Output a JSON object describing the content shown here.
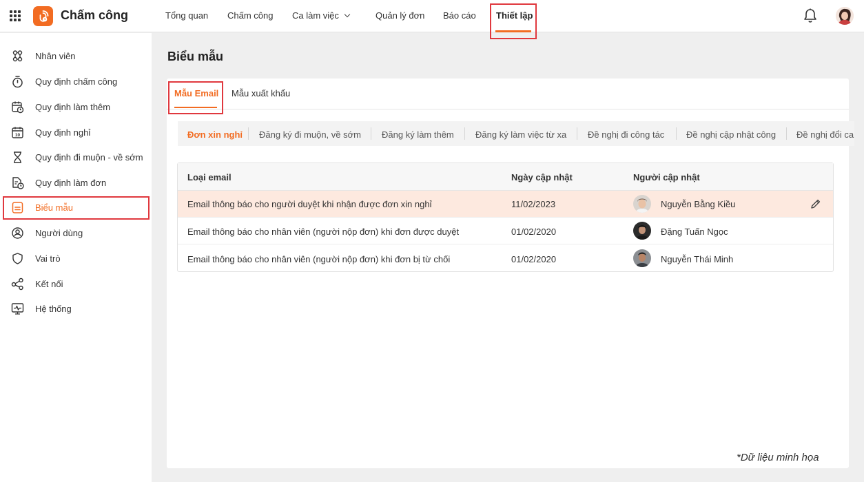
{
  "app": {
    "title": "Chấm công",
    "accent_color": "#f26c22",
    "highlight_color": "#e0383e"
  },
  "topnav": {
    "items": [
      {
        "label": "Tổng quan"
      },
      {
        "label": "Chấm công"
      },
      {
        "label": "Ca làm việc",
        "icon": "chevron-down-icon"
      },
      {
        "label": "Quản lý đơn"
      },
      {
        "label": "Báo cáo"
      },
      {
        "label": "Thiết lập",
        "active": true
      }
    ]
  },
  "sidebar": {
    "items": [
      {
        "label": "Nhân viên",
        "icon": "people-network-icon"
      },
      {
        "label": "Quy định chấm công",
        "icon": "stopwatch-icon"
      },
      {
        "label": "Quy định làm thêm",
        "icon": "overtime-calendar-icon"
      },
      {
        "label": "Quy định nghỉ",
        "icon": "calendar-10-icon"
      },
      {
        "label": "Quy định đi muộn - về sớm",
        "icon": "hourglass-icon"
      },
      {
        "label": "Quy định làm đơn",
        "icon": "document-clock-icon"
      },
      {
        "label": "Biểu mẫu",
        "icon": "form-icon",
        "active": true
      },
      {
        "label": "Người dùng",
        "icon": "user-circle-icon"
      },
      {
        "label": "Vai trò",
        "icon": "shield-icon"
      },
      {
        "label": "Kết nối",
        "icon": "share-icon"
      },
      {
        "label": "Hệ thống",
        "icon": "monitor-icon"
      }
    ]
  },
  "main": {
    "title": "Biểu mẫu",
    "tabs": [
      {
        "label": "Mẫu Email",
        "active": true
      },
      {
        "label": "Mẫu xuất khẩu"
      }
    ],
    "subtabs": [
      {
        "label": "Đơn xin nghỉ",
        "active": true
      },
      {
        "label": "Đăng ký đi muộn, về sớm"
      },
      {
        "label": "Đăng ký làm thêm"
      },
      {
        "label": "Đăng ký làm việc từ xa"
      },
      {
        "label": "Đề nghị đi công tác"
      },
      {
        "label": "Đề nghị cập nhật công"
      },
      {
        "label": "Đề nghị đổi ca"
      }
    ],
    "table": {
      "columns": [
        "Loại email",
        "Ngày cập nhật",
        "Người cập nhật"
      ],
      "rows": [
        {
          "type": "Email thông báo cho người duyệt khi nhận được đơn xin nghỉ",
          "date": "11/02/2023",
          "user": "Nguyễn Bằng Kiều",
          "highlighted": true
        },
        {
          "type": "Email thông báo cho nhân viên (người nộp đơn) khi đơn được duyệt",
          "date": "01/02/2020",
          "user": "Đặng Tuấn Ngọc"
        },
        {
          "type": "Email thông báo cho nhân viên (người nộp đơn) khi đơn bị từ chối",
          "date": "01/02/2020",
          "user": "Nguyễn Thái Minh"
        }
      ]
    },
    "note": "*Dữ liệu minh họa"
  }
}
